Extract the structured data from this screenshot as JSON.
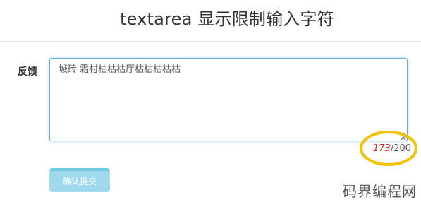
{
  "page": {
    "title": "textarea 显示限制输入字符"
  },
  "form": {
    "feedback_label": "反馈",
    "feedback_value": "城砖 霜村枯枯枯厅枯枯枯枯枯",
    "char_count": "173",
    "char_separator": "/",
    "char_limit": "200",
    "submit_label": "确认提交"
  },
  "watermark": {
    "text": "码界编程网"
  },
  "colors": {
    "textarea_focus_border": "#66afe9",
    "count_text": "#c9302c",
    "button_background": "#8fd3ea",
    "highlight_ring": "#f2c200"
  },
  "icons": {
    "resize_grip": "resize-grip-icon"
  }
}
